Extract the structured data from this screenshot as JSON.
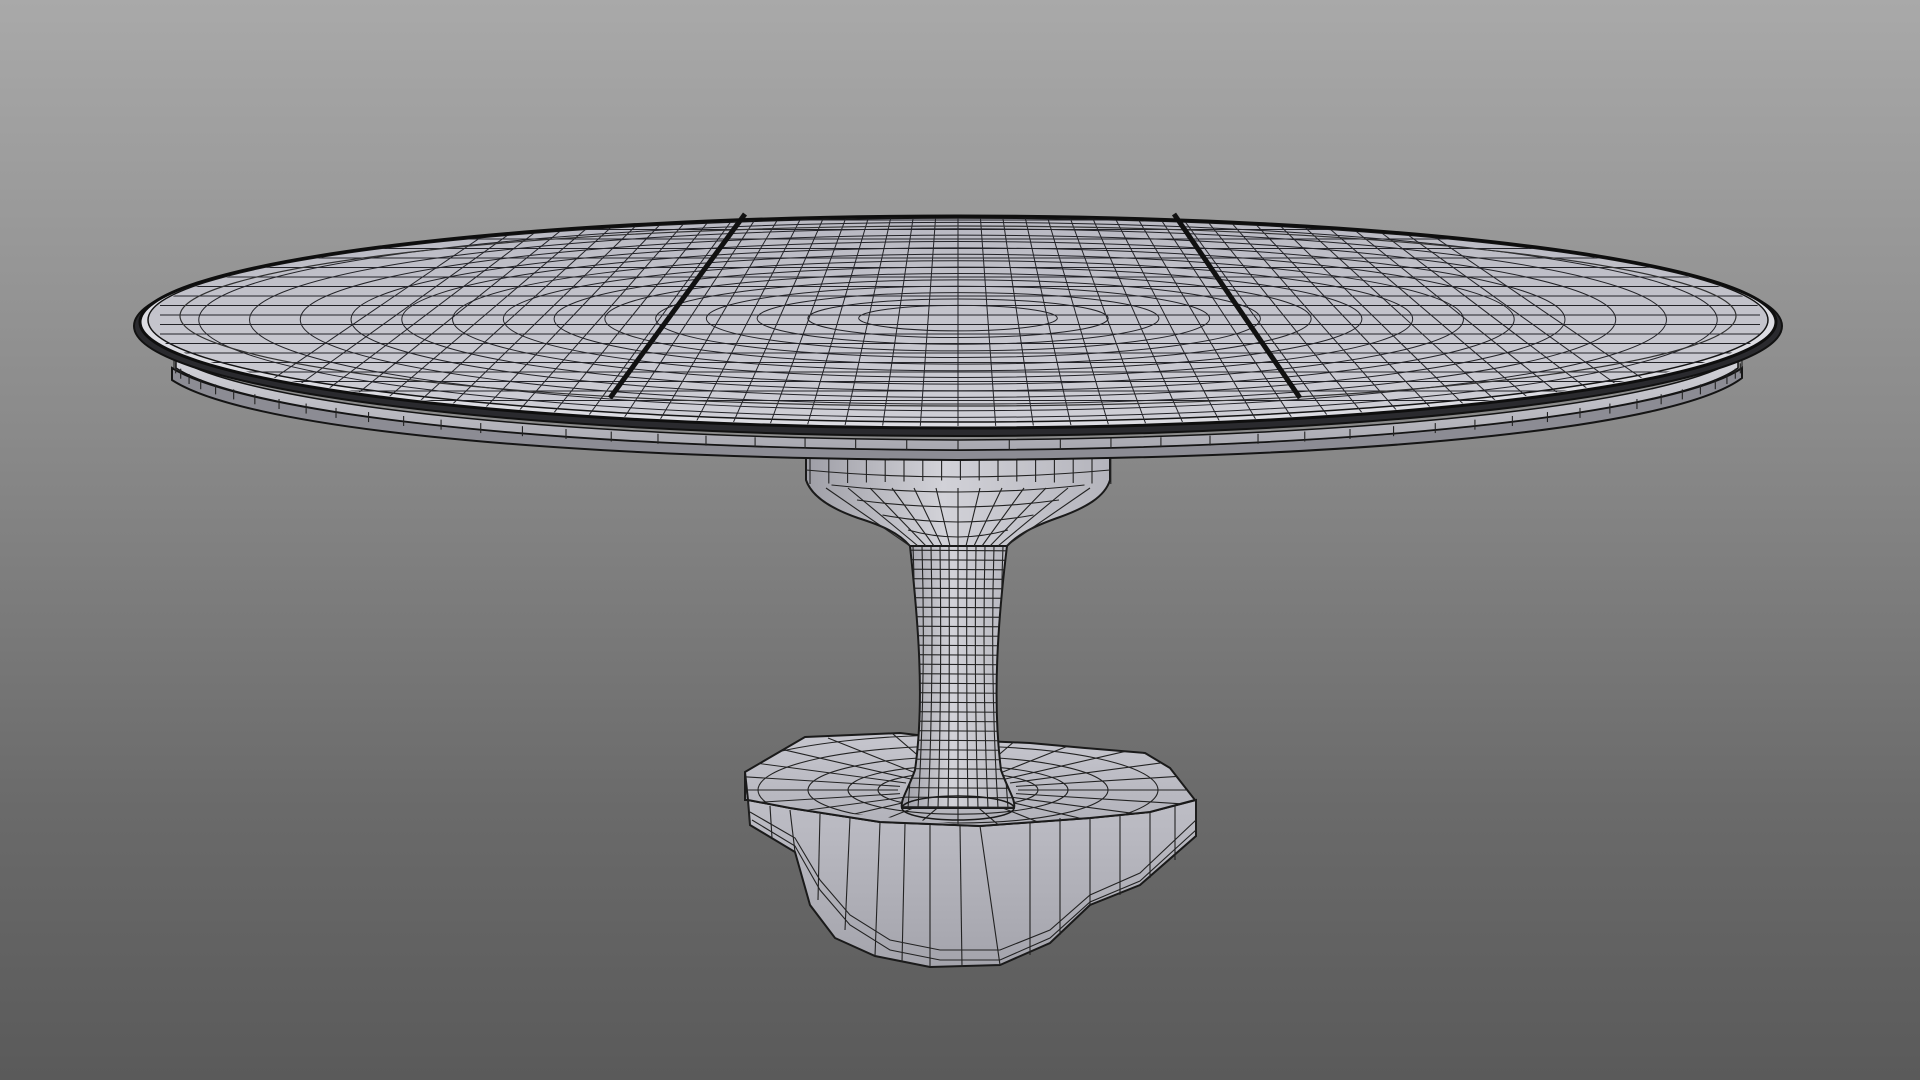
{
  "scene": {
    "subject": "pedestal-table-wireframe",
    "background_top_color": "#a9a9a9",
    "background_bottom_color": "#5a5a5a",
    "surface_color": "#c4c4cc",
    "surface_shadow_color": "#9a9aa4",
    "wire_color": "#1a1a1a",
    "edge_dark_color": "#141414"
  }
}
